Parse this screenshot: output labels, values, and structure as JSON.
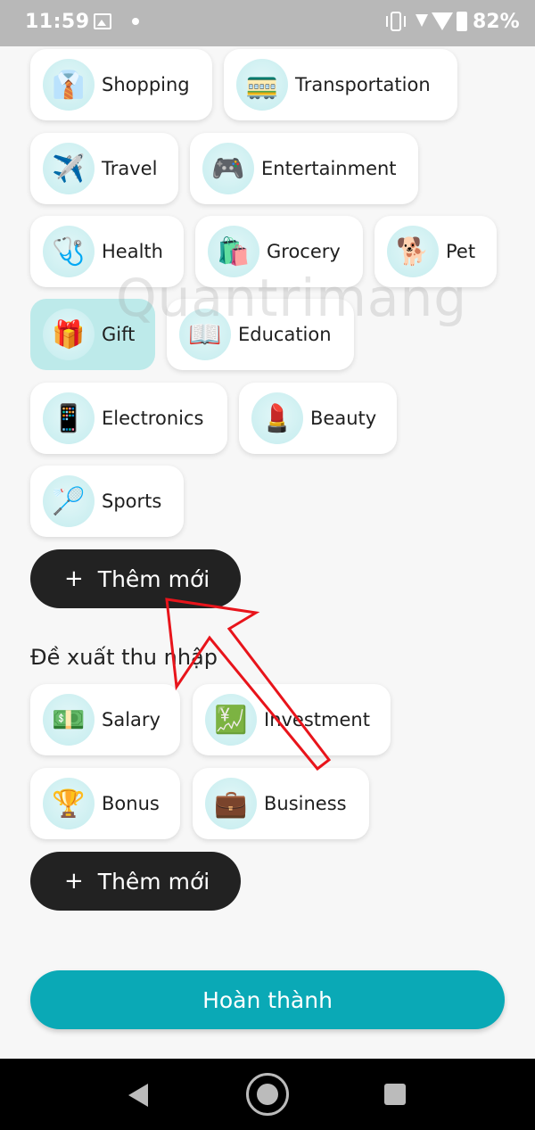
{
  "status_bar": {
    "time": "11:59",
    "battery": "82%"
  },
  "expense_categories": [
    {
      "label": "Shopping",
      "icon": "👔",
      "icon_name": "clothes-icon",
      "selected": true
    },
    {
      "label": "Transportation",
      "icon": "🚃",
      "icon_name": "train-icon",
      "selected": false
    },
    {
      "label": "Travel",
      "icon": "✈️",
      "icon_name": "airplane-icon",
      "selected": false
    },
    {
      "label": "Entertainment",
      "icon": "🎮",
      "icon_name": "gamepad-icon",
      "selected": false
    },
    {
      "label": "Health",
      "icon": "🩺",
      "icon_name": "medical-kit-icon",
      "selected": false
    },
    {
      "label": "Grocery",
      "icon": "🛍️",
      "icon_name": "grocery-bag-icon",
      "selected": false
    },
    {
      "label": "Pet",
      "icon": "🐕",
      "icon_name": "dog-icon",
      "selected": false
    },
    {
      "label": "Gift",
      "icon": "🎁",
      "icon_name": "gift-icon",
      "selected": true
    },
    {
      "label": "Education",
      "icon": "📖",
      "icon_name": "book-icon",
      "selected": false
    },
    {
      "label": "Electronics",
      "icon": "📱",
      "icon_name": "phone-icon",
      "selected": false
    },
    {
      "label": "Beauty",
      "icon": "💄",
      "icon_name": "cosmetics-icon",
      "selected": false
    },
    {
      "label": "Sports",
      "icon": "🏸",
      "icon_name": "racket-icon",
      "selected": false
    }
  ],
  "add_new_label": "Thêm mới",
  "income_section_title": "Đề xuất thu nhập",
  "income_categories": [
    {
      "label": "Salary",
      "icon": "💵",
      "icon_name": "money-icon",
      "selected": false
    },
    {
      "label": "Investment",
      "icon": "💹",
      "icon_name": "investment-icon",
      "selected": false
    },
    {
      "label": "Bonus",
      "icon": "🏆",
      "icon_name": "trophy-icon",
      "selected": false
    },
    {
      "label": "Business",
      "icon": "💼",
      "icon_name": "briefcase-icon",
      "selected": false
    }
  ],
  "done_label": "Hoàn thành",
  "watermark": "Quantrimang",
  "colors": {
    "accent": "#0aa9b6",
    "selected_chip": "#bdeaea",
    "dark_button": "#222222",
    "arrow": "#e8141b"
  }
}
